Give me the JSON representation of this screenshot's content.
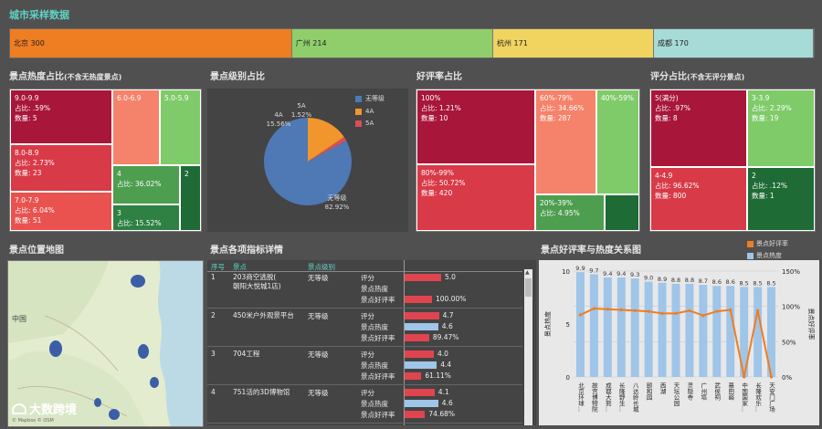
{
  "header": {
    "title": "城市采样数据"
  },
  "cities": [
    {
      "label": "北京 300",
      "value": 300,
      "color": "#ef7d22"
    },
    {
      "label": "广州 214",
      "value": 214,
      "color": "#8fce6b"
    },
    {
      "label": "杭州 171",
      "value": 171,
      "color": "#f1d360"
    },
    {
      "label": "成都 170",
      "value": 170,
      "color": "#a6dbd7"
    }
  ],
  "sections": {
    "heat": "景点热度占比",
    "heat_note": "(不含无热度景点)",
    "level": "景点级别占比",
    "good": "好评率占比",
    "score": "评分占比",
    "score_note": "(不含无评分景点)",
    "map": "景点位置地图",
    "detail": "景点各项指标详情",
    "relation": "景点好评率与热度关系图"
  },
  "heat_cells": [
    {
      "text": "9.0-9.9\n占比: .59%\n数量: 5",
      "color": "#a8163a"
    },
    {
      "text": "6.0-6.9",
      "color": "#f5826a"
    },
    {
      "text": "5.0-5.9",
      "color": "#7fcb6a"
    },
    {
      "text": "8.0-8.9\n占比: 2.73%\n数量: 23",
      "color": "#d93a48"
    },
    {
      "text": "4\n占比: 36.02%",
      "color": "#4e9e50"
    },
    {
      "text": "2",
      "color": "#1e6b36"
    },
    {
      "text": "7.0-7.9\n占比: 6.04%\n数量: 51",
      "color": "#e9524f"
    },
    {
      "text": "3\n占比: 15.52%",
      "color": "#2f8143"
    }
  ],
  "level_pie": {
    "legend": [
      "无等级",
      "4A",
      "5A"
    ],
    "colors": [
      "#4e79b5",
      "#f0962c",
      "#d94f55"
    ],
    "labels": [
      {
        "name": "5A",
        "pct": "1.52%"
      },
      {
        "name": "4A",
        "pct": "15.56%"
      },
      {
        "name": "无等级",
        "pct": "82.92%"
      }
    ]
  },
  "good_cells": [
    {
      "text": "100%\n占比: 1.21%\n数量: 10",
      "color": "#a8163a"
    },
    {
      "text": "60%-79%\n占比: 34.66%\n数量: 287",
      "color": "#f5826a"
    },
    {
      "text": "40%-59%",
      "color": "#7fcb6a"
    },
    {
      "text": "80%-99%\n占比: 50.72%\n数量: 420",
      "color": "#d93a48"
    },
    {
      "text": "20%-39%\n占比: 4.95%",
      "color": "#4e9e50"
    },
    {
      "text": "",
      "color": "#1e6b36"
    }
  ],
  "score_cells": [
    {
      "text": "5(满分)\n占比: .97%\n数量: 8",
      "color": "#a8163a"
    },
    {
      "text": "3-3.9\n占比: 2.29%\n数量: 19",
      "color": "#7fcb6a"
    },
    {
      "text": "4-4.9\n占比: 96.62%\n数量: 800",
      "color": "#d93a48"
    },
    {
      "text": "2\n占比: .12%\n数量: 1",
      "color": "#1e6b36"
    }
  ],
  "map": {
    "label": "中国",
    "watermark": "大数跨境",
    "credit": "© Mapbox © OSM"
  },
  "detail_table": {
    "headers": [
      "序号",
      "景点",
      "景点级别"
    ],
    "metrics": [
      "评分",
      "景点热度",
      "景点好评率"
    ],
    "rows": [
      {
        "no": "1",
        "name": "203商空逃脱(\n朝阳大悦城1店)",
        "level": "无等级",
        "score": 5.0,
        "heat": null,
        "good": "100.00%",
        "score_text": "5.0",
        "heat_text": "",
        "good_val": 1.0
      },
      {
        "no": "2",
        "name": "450米户外观景平台",
        "level": "无等级",
        "score": 4.7,
        "heat": 4.6,
        "good": "89.47%",
        "score_text": "4.7",
        "heat_text": "4.6",
        "good_val": 0.8947
      },
      {
        "no": "3",
        "name": "704工程",
        "level": "无等级",
        "score": 4.0,
        "heat": 4.4,
        "good": "61.11%",
        "score_text": "4.0",
        "heat_text": "4.4",
        "good_val": 0.6111
      },
      {
        "no": "4",
        "name": "751活的3D博物馆",
        "level": "无等级",
        "score": 4.1,
        "heat": 4.6,
        "good": "74.68%",
        "score_text": "4.1",
        "heat_text": "4.6",
        "good_val": 0.7468
      }
    ]
  },
  "chart_data": {
    "type": "bar",
    "title": "景点好评率与热度关系图",
    "legend": [
      "景点好评率",
      "景点热度"
    ],
    "categories": [
      "北京环球...",
      "故宫博物院",
      "成都大熊...",
      "长隆野生...",
      "八达岭长城",
      "颐和园",
      "西湖",
      "天坛公园",
      "灵隐寺",
      "广州塔",
      "武侯祠",
      "慕田峪",
      "中国国家...",
      "长隆欢乐...",
      "天安门广场"
    ],
    "series": [
      {
        "name": "景点热度",
        "values": [
          9.9,
          9.7,
          9.4,
          9.4,
          9.3,
          9.0,
          8.9,
          8.8,
          8.8,
          8.7,
          8.6,
          8.6,
          8.5,
          8.5,
          8.5
        ]
      },
      {
        "name": "景点好评率",
        "values": [
          0.88,
          0.97,
          0.96,
          0.95,
          0.94,
          0.93,
          0.9,
          0.9,
          0.94,
          0.87,
          0.93,
          0.95,
          0.0,
          0.94,
          0.0
        ]
      }
    ],
    "ylabel_left": "景点热度",
    "ylabel_right": "景点好评率",
    "ylim_left": [
      0,
      10
    ],
    "ylim_right": [
      0,
      1.5
    ],
    "yticks_left": [
      "0",
      "5",
      "10"
    ],
    "yticks_right": [
      "0%",
      "50%",
      "100%",
      "150%"
    ],
    "bar_labels": [
      "9.9",
      "9.7",
      "9.4",
      "9.4",
      "9.3",
      "9.0",
      "8.9",
      "8.8",
      "8.8",
      "8.7",
      "8.6",
      "8.6",
      "8.5",
      "8.5",
      "8.5"
    ]
  },
  "colors": {
    "bar": "#9fc5e8",
    "line": "#ef7d22"
  }
}
